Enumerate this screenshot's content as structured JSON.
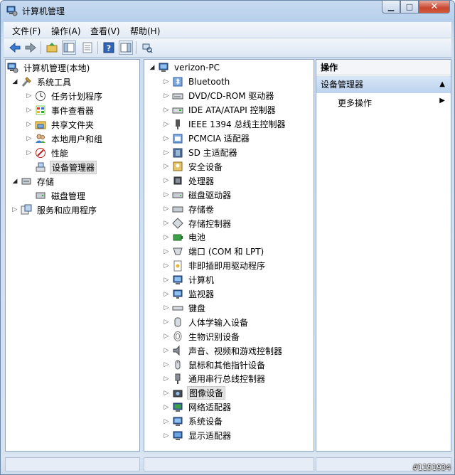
{
  "window": {
    "title": "计算机管理",
    "minimize_glyph": "▁",
    "maximize_glyph": "□",
    "close_glyph": "✕"
  },
  "menu": [
    "文件(F)",
    "操作(A)",
    "查看(V)",
    "帮助(H)"
  ],
  "toolbar": {
    "icons": [
      "back-arrow-icon",
      "forward-arrow-icon",
      "up-folder-icon",
      "show-hide-console-tree-icon",
      "properties-icon",
      "help-icon",
      "show-hide-action-pane-icon",
      "scan-hardware-icon"
    ]
  },
  "left_tree": {
    "root": "计算机管理(本地)",
    "system_tools": "系统工具",
    "system_children": [
      "任务计划程序",
      "事件查看器",
      "共享文件夹",
      "本地用户和组",
      "性能",
      "设备管理器"
    ],
    "storage": "存储",
    "storage_children": [
      "磁盘管理"
    ],
    "services": "服务和应用程序"
  },
  "device_tree": {
    "root": "verizon-PC",
    "categories": [
      "Bluetooth",
      "DVD/CD-ROM 驱动器",
      "IDE ATA/ATAPI 控制器",
      "IEEE 1394 总线主控制器",
      "PCMCIA 适配器",
      "SD 主适配器",
      "安全设备",
      "处理器",
      "磁盘驱动器",
      "存储卷",
      "存储控制器",
      "电池",
      "端口 (COM 和 LPT)",
      "非即插即用驱动程序",
      "计算机",
      "监视器",
      "键盘",
      "人体学输入设备",
      "生物识别设备",
      "声音、视频和游戏控制器",
      "鼠标和其他指针设备",
      "通用串行总线控制器",
      "图像设备",
      "网络适配器",
      "系统设备",
      "显示适配器"
    ],
    "selected": "图像设备"
  },
  "actions": {
    "header": "操作",
    "section": "设备管理器",
    "more": "更多操作"
  },
  "watermark": "#1151934"
}
